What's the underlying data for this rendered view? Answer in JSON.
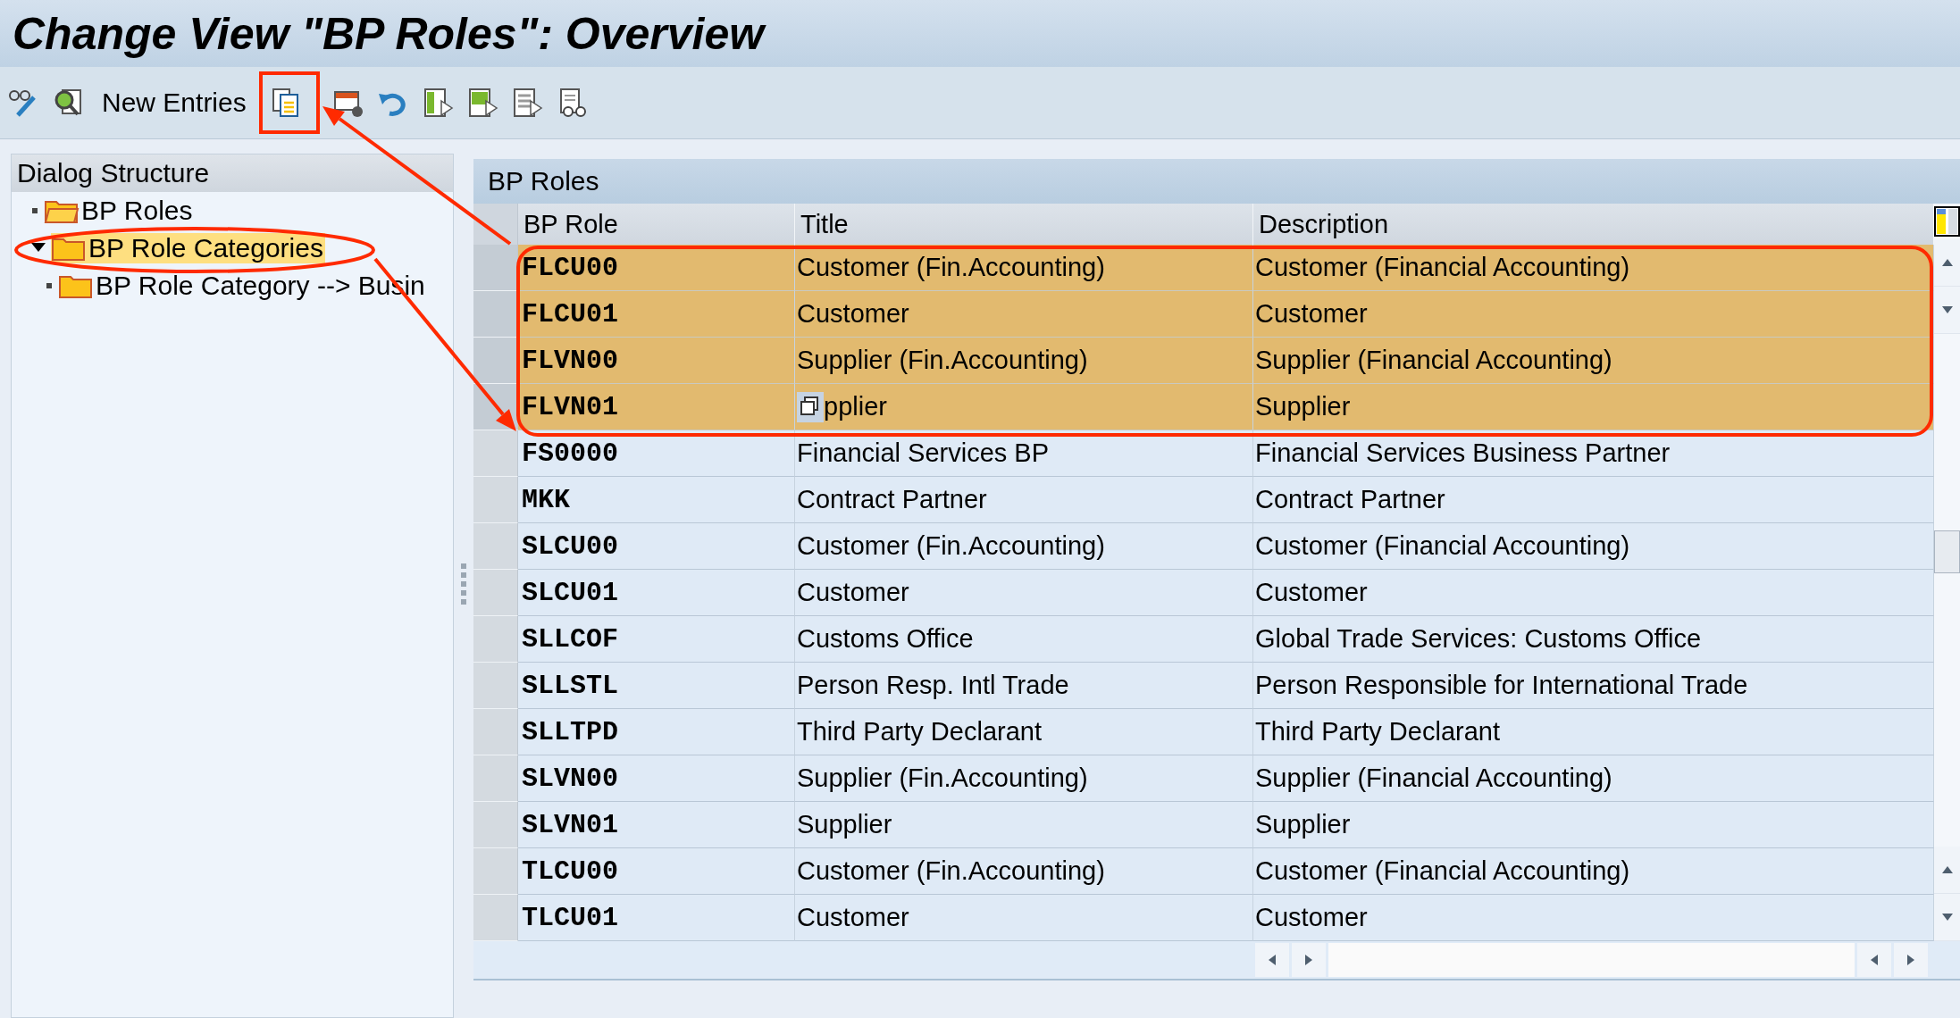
{
  "window": {
    "title": "Change View \"BP Roles\": Overview"
  },
  "toolbar": {
    "new_entries": "New Entries"
  },
  "dialog_structure": {
    "title": "Dialog Structure",
    "items": [
      {
        "label": "BP Roles",
        "expanded": false,
        "selected": false
      },
      {
        "label": "BP Role Categories",
        "expanded": true,
        "selected": true,
        "children": [
          {
            "label": "BP Role Category --> Busin",
            "expanded": false,
            "selected": false
          }
        ]
      }
    ]
  },
  "table": {
    "title": "BP Roles",
    "columns": [
      "BP Role",
      "Title",
      "Description"
    ],
    "rows": [
      {
        "role": "FLCU00",
        "title": "Customer (Fin.Accounting)",
        "description": "Customer (Financial Accounting)",
        "selected": true
      },
      {
        "role": "FLCU01",
        "title": "Customer",
        "description": "Customer",
        "selected": true
      },
      {
        "role": "FLVN00",
        "title": "Supplier (Fin.Accounting)",
        "description": "Supplier (Financial Accounting)",
        "selected": true
      },
      {
        "role": "FLVN01",
        "title": "pplier",
        "description": "Supplier",
        "selected": true,
        "copy_icon": true
      },
      {
        "role": "FS0000",
        "title": "Financial Services BP",
        "description": "Financial Services Business Partner",
        "selected": false
      },
      {
        "role": "MKK",
        "title": "Contract Partner",
        "description": "Contract Partner",
        "selected": false
      },
      {
        "role": "SLCU00",
        "title": "Customer (Fin.Accounting)",
        "description": "Customer (Financial Accounting)",
        "selected": false
      },
      {
        "role": "SLCU01",
        "title": "Customer",
        "description": "Customer",
        "selected": false
      },
      {
        "role": "SLLCOF",
        "title": "Customs Office",
        "description": "Global Trade Services: Customs Office",
        "selected": false
      },
      {
        "role": "SLLSTL",
        "title": "Person Resp. Intl Trade",
        "description": "Person Responsible for International Trade",
        "selected": false
      },
      {
        "role": "SLLTPD",
        "title": "Third Party Declarant",
        "description": "Third Party Declarant",
        "selected": false
      },
      {
        "role": "SLVN00",
        "title": "Supplier (Fin.Accounting)",
        "description": "Supplier (Financial Accounting)",
        "selected": false
      },
      {
        "role": "SLVN01",
        "title": "Supplier",
        "description": "Supplier",
        "selected": false
      },
      {
        "role": "TLCU00",
        "title": "Customer (Fin.Accounting)",
        "description": "Customer (Financial Accounting)",
        "selected": false
      },
      {
        "role": "TLCU01",
        "title": "Customer",
        "description": "Customer",
        "selected": false
      }
    ]
  }
}
